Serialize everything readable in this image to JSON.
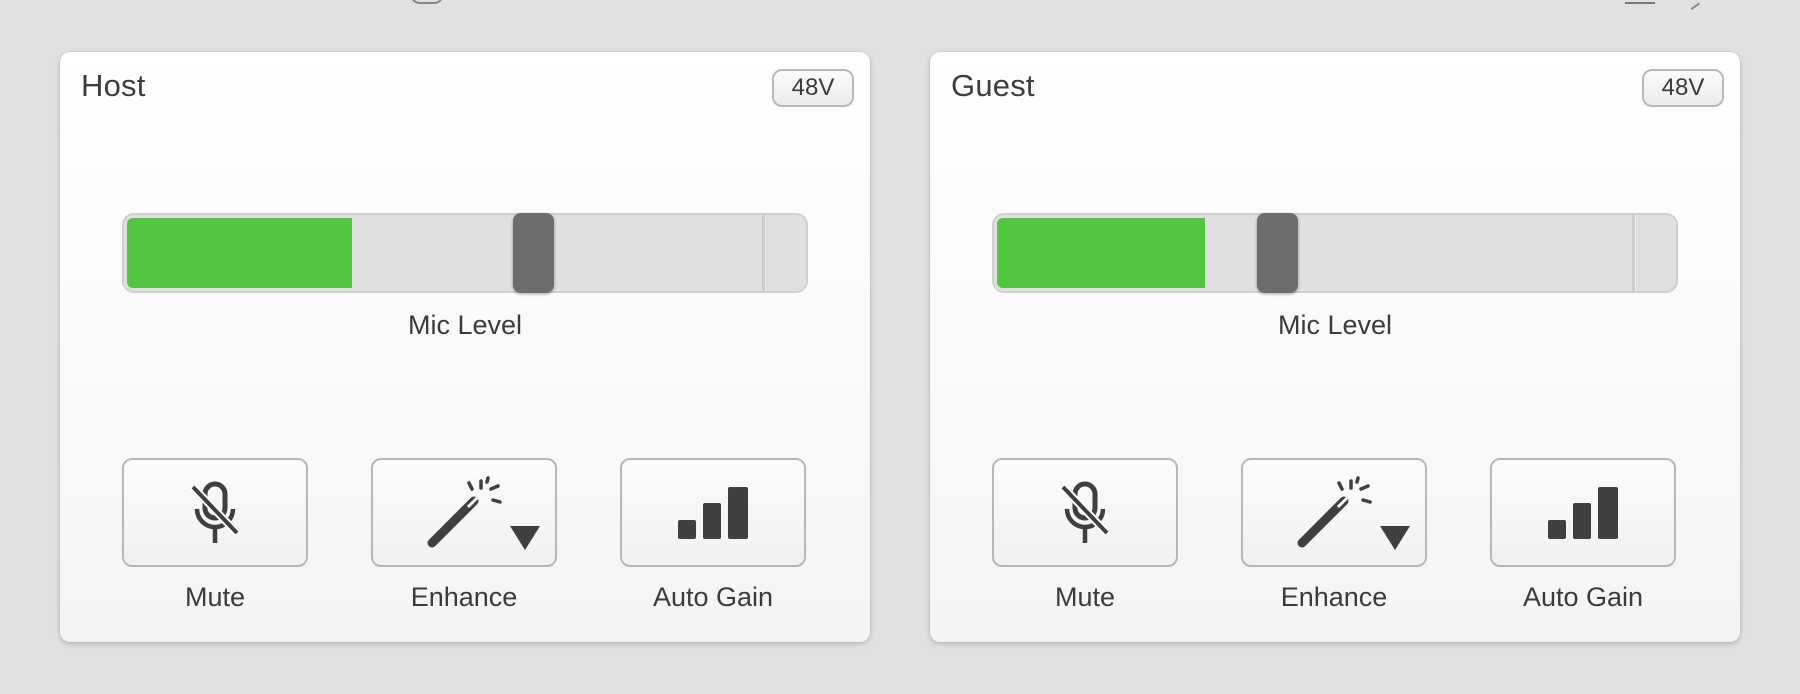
{
  "colors": {
    "meter_fill": "#52c541",
    "thumb": "#6d6d6d",
    "icon": "#3f3f3f"
  },
  "channels": [
    {
      "title": "Host",
      "phantom_label": "48V",
      "meter": {
        "level_fraction": 0.33,
        "fader_fraction": 0.6,
        "peak_fraction": 0.935,
        "label": "Mic Level"
      },
      "controls": [
        {
          "label": "Mute",
          "icon": "mic-off-icon"
        },
        {
          "label": "Enhance",
          "icon": "magic-wand-icon",
          "has_dropdown": true
        },
        {
          "label": "Auto Gain",
          "icon": "signal-bars-icon"
        }
      ]
    },
    {
      "title": "Guest",
      "phantom_label": "48V",
      "meter": {
        "level_fraction": 0.305,
        "fader_fraction": 0.415,
        "peak_fraction": 0.935,
        "label": "Mic Level"
      },
      "controls": [
        {
          "label": "Mute",
          "icon": "mic-off-icon"
        },
        {
          "label": "Enhance",
          "icon": "magic-wand-icon",
          "has_dropdown": true
        },
        {
          "label": "Auto Gain",
          "icon": "signal-bars-icon"
        }
      ]
    }
  ]
}
